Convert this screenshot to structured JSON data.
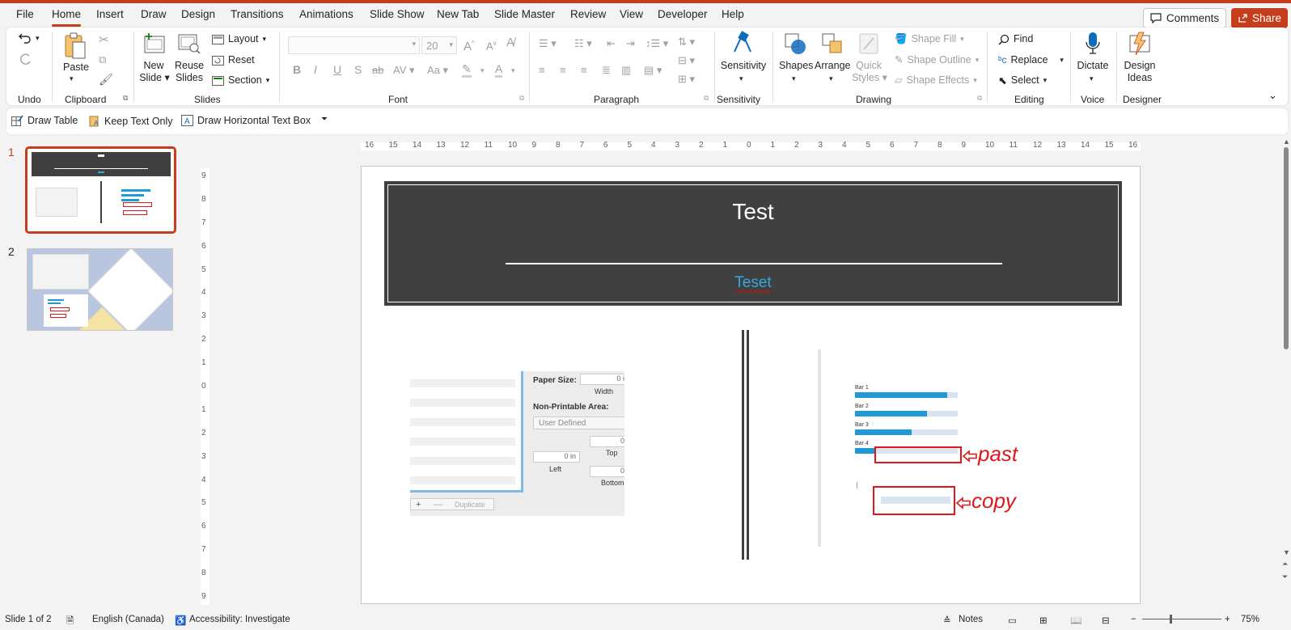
{
  "menu": {
    "tabs": [
      "File",
      "Home",
      "Insert",
      "Draw",
      "Design",
      "Transitions",
      "Animations",
      "Slide Show",
      "New Tab",
      "Slide Master",
      "Review",
      "View",
      "Developer",
      "Help"
    ],
    "active_tab": "Home",
    "comments": "Comments",
    "share": "Share"
  },
  "ribbon": {
    "undo_group": "Undo",
    "clipboard_group": "Clipboard",
    "paste": "Paste",
    "slides_group": "Slides",
    "new_slide": "New",
    "new_slide2": "Slide",
    "reuse": "Reuse",
    "reuse2": "Slides",
    "layout": "Layout",
    "reset": "Reset",
    "section": "Section",
    "font_group": "Font",
    "font_size": "20",
    "paragraph_group": "Paragraph",
    "sensitivity": "Sensitivity",
    "sensitivity_group": "Sensitivity",
    "shapes": "Shapes",
    "arrange": "Arrange",
    "quick_styles": "Quick",
    "quick_styles2": "Styles",
    "shape_fill": "Shape Fill",
    "shape_outline": "Shape Outline",
    "shape_effects": "Shape Effects",
    "drawing_group": "Drawing",
    "find": "Find",
    "replace": "Replace",
    "select": "Select",
    "editing_group": "Editing",
    "dictate": "Dictate",
    "voice_group": "Voice",
    "design_ideas": "Design",
    "design_ideas2": "Ideas",
    "designer_group": "Designer"
  },
  "qat": {
    "draw_table": "Draw Table",
    "keep_text_only": "Keep Text Only",
    "draw_text_box": "Draw Horizontal Text Box"
  },
  "thumbnails": [
    {
      "number": "1"
    },
    {
      "number": "2"
    }
  ],
  "ruler": {
    "h_ticks": [
      "16",
      "15",
      "14",
      "13",
      "12",
      "11",
      "10",
      "9",
      "8",
      "7",
      "6",
      "5",
      "4",
      "3",
      "2",
      "1",
      "0",
      "1",
      "2",
      "3",
      "4",
      "5",
      "6",
      "7",
      "8",
      "9",
      "10",
      "11",
      "12",
      "13",
      "14",
      "15",
      "16"
    ],
    "v_ticks": [
      "9",
      "8",
      "7",
      "6",
      "5",
      "4",
      "3",
      "2",
      "1",
      "0",
      "1",
      "2",
      "3",
      "4",
      "5",
      "6",
      "7",
      "8",
      "9"
    ]
  },
  "slide": {
    "title": "Test",
    "subtitle": "Teset",
    "left_image": {
      "paper_size": "Paper Size:",
      "width_val": "0 i",
      "width": "Width",
      "non_printable": "Non-Printable Area:",
      "user_defined": "User Defined",
      "top_val": "0",
      "top": "Top",
      "left_val": "0 in",
      "left": "Left",
      "bottom_val": "0",
      "bottom": "Bottom",
      "duplicate": "Duplicate"
    },
    "right_image": {
      "bars": [
        {
          "label": "Bar 1",
          "value": 0.9
        },
        {
          "label": "Bar 2",
          "value": 0.7
        },
        {
          "label": "Bar 3",
          "value": 0.55
        },
        {
          "label": "Bar 4",
          "value": 0.2
        }
      ],
      "past": "past",
      "copy": "copy"
    }
  },
  "status": {
    "slide_info": "Slide 1 of 2",
    "language": "English (Canada)",
    "accessibility": "Accessibility: Investigate",
    "notes": "Notes",
    "zoom": "75%"
  },
  "colors": {
    "accent": "#c43e1c",
    "title_bg": "#404040",
    "subtitle": "#35a8e0",
    "annotation_red": "#e0161c",
    "bar_blue": "#1f9ad6"
  }
}
